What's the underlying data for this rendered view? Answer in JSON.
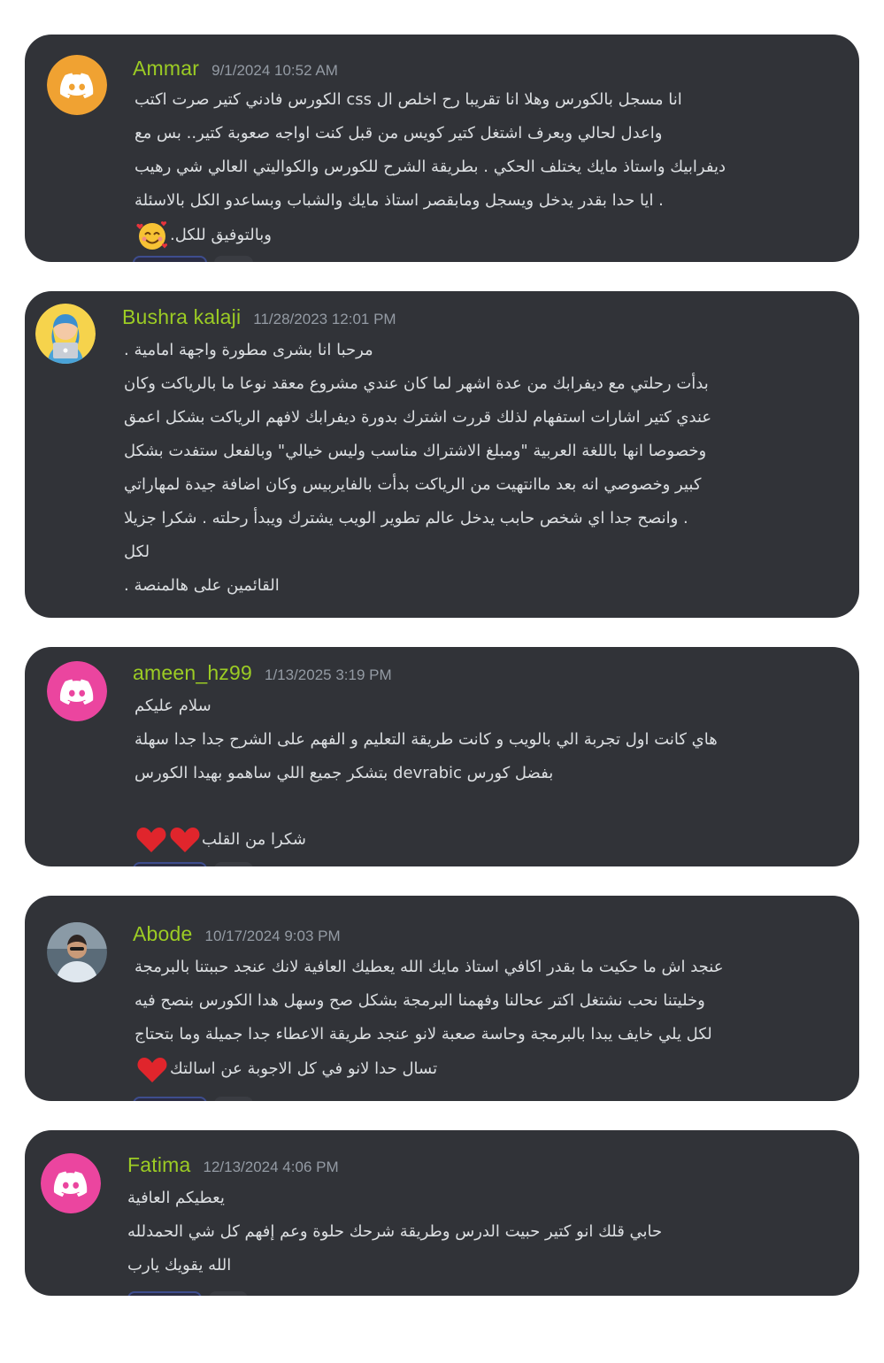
{
  "reviews": [
    {
      "username": "Ammar",
      "timestamp": "9/1/2024 10:52 AM",
      "avatar_icon": "discord-logo-icon",
      "avatar_color": "#f0a232",
      "lines": [
        "انا مسجل بالكورس وهلا انا تقريبا رح اخلص ال css الكورس فادني كتير صرت اكتب",
        "واعدل لحالي وبعرف اشتغل كتير كويس من قبل كنت اواجه صعوبة كتير.. بس مع",
        "ديفرابيك واستاذ مايك يختلف الحكي . بطريقة الشرح للكورس والكواليتي العالي شي رهيب",
        ". ايا حدا بقدر يدخل ويسجل ومابقصر استاذ مايك والشباب وبساعدو الكل بالاسئلة",
        "وبالتوفيق للكل."
      ],
      "emoji": "smiling-face-with-hearts-icon"
    },
    {
      "username": "Bushra kalaji",
      "timestamp": "11/28/2023 12:01 PM",
      "avatar_icon": "person-with-laptop-avatar-icon",
      "avatar_color": "#f6d34c",
      "lines": [
        "مرحبا انا بشرى مطورة واجهة امامية .",
        "بدأت رحلتي مع ديفرابك من عدة اشهر لما كان عندي مشروع معقد نوعا ما بالرياكت وكان",
        "عندي كتير اشارات استفهام لذلك قررت اشترك بدورة ديفرابك لافهم الرياكت بشكل اعمق",
        "وخصوصا انها باللغة العربية \"ومبلغ الاشتراك مناسب وليس خيالي\" وبالفعل ستفدت بشكل",
        "كبير وخصوصي انه بعد ماانتهيت من الرياكت بدأت بالفايربيس وكان اضافة جيدة لمهاراتي",
        ". وانصح جدا اي شخص حابب يدخل عالم تطوير الويب يشترك ويبدأ رحلته . شكرا جزيلا",
        "لكل",
        "القائمين على هالمنصة ."
      ]
    },
    {
      "username": "ameen_hz99",
      "timestamp": "1/13/2025 3:19 PM",
      "avatar_icon": "discord-logo-icon",
      "avatar_color": "#eb459f",
      "lines": [
        "سلام عليكم",
        "هاي كانت اول تجربة الي بالويب و كانت طريقة التعليم و الفهم على الشرح جدا جدا سهلة",
        "بفضل كورس devrabic بتشكر جميع اللي ساهمو بهيدا الكورس",
        "",
        "شكرا من القلب"
      ],
      "emoji": "two-red-hearts-icon"
    },
    {
      "username": "Abode",
      "timestamp": "10/17/2024 9:03 PM",
      "avatar_icon": "person-photo-avatar-icon",
      "avatar_color": "#5a6b78",
      "lines": [
        "عنجد اش ما حكيت ما بقدر اكافي استاذ مايك الله يعطيك العافية لانك عنجد حببتنا بالبرمجة",
        "وخليتنا نحب نشتغل اكتر عحالنا وفهمنا البرمجة بشكل صح وسهل هدا الكورس بنصح فيه",
        "لكل يلي خايف يبدا بالبرمجة وحاسة صعبة لانو عنجد طريقة الاعطاء جدا جميلة وما بتحتاج",
        "تسال حدا لانو في كل الاجوبة عن اسالتك"
      ],
      "emoji": "red-heart-icon"
    },
    {
      "username": "Fatima",
      "timestamp": "12/13/2024 4:06 PM",
      "avatar_icon": "discord-logo-icon",
      "avatar_color": "#eb459f",
      "lines": [
        "يعطيكم العافية",
        "حابي قلك انو كتير حبيت الدرس وطريقة شرحك حلوة وعم إفهم كل شي الحمدلله",
        "الله يقويك يارب"
      ]
    }
  ]
}
